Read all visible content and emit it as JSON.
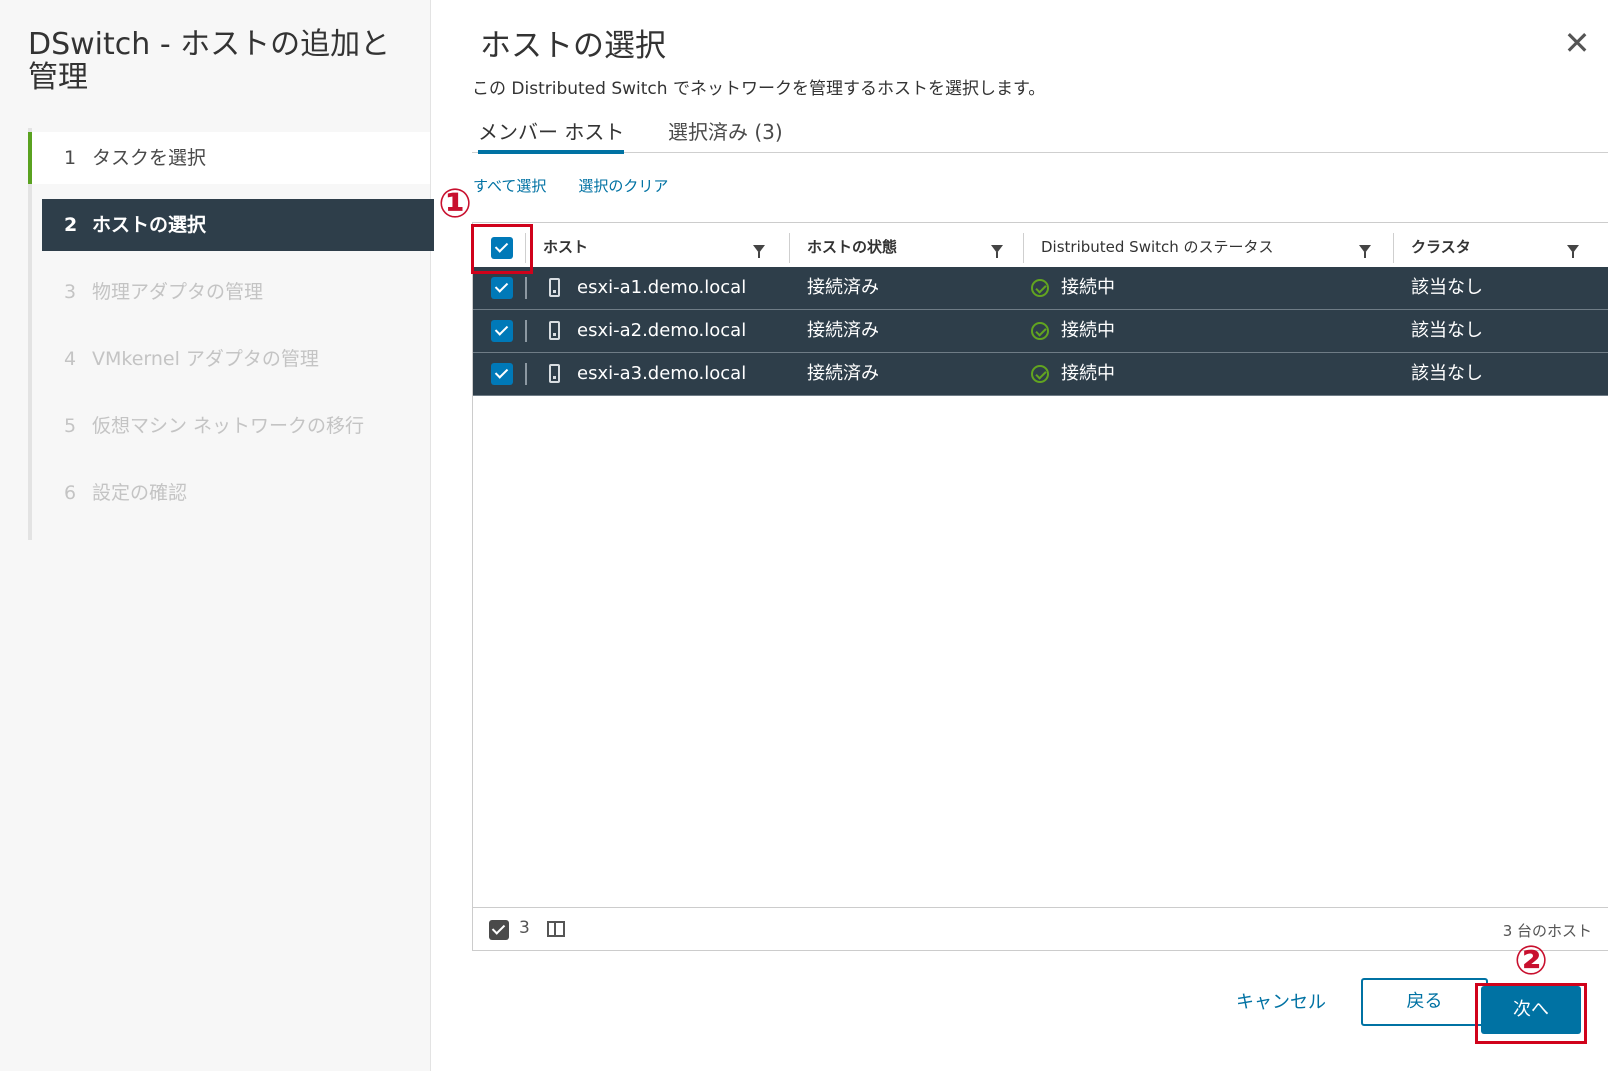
{
  "wizard": {
    "title": "DSwitch - ホストの追加と管理",
    "steps": [
      {
        "num": "1",
        "label": "タスクを選択"
      },
      {
        "num": "2",
        "label": "ホストの選択"
      },
      {
        "num": "3",
        "label": "物理アダプタの管理"
      },
      {
        "num": "4",
        "label": "VMkernel アダプタの管理"
      },
      {
        "num": "5",
        "label": "仮想マシン ネットワークの移行"
      },
      {
        "num": "6",
        "label": "設定の確認"
      }
    ]
  },
  "page": {
    "title": "ホストの選択",
    "subtitle": "この Distributed Switch でネットワークを管理するホストを選択します。",
    "close_icon": "close-icon"
  },
  "tabs": [
    {
      "label": "メンバー ホスト"
    },
    {
      "label": "選択済み (3)"
    }
  ],
  "links": {
    "select_all": "すべて選択",
    "clear_selection": "選択のクリア"
  },
  "grid": {
    "columns": [
      "ホスト",
      "ホストの状態",
      "Distributed Switch のステータス",
      "クラスタ"
    ],
    "rows": [
      {
        "host": "esxi-a1.demo.local",
        "state": "接続済み",
        "ds_status": "接続中",
        "cluster": "該当なし"
      },
      {
        "host": "esxi-a2.demo.local",
        "state": "接続済み",
        "ds_status": "接続中",
        "cluster": "該当なし"
      },
      {
        "host": "esxi-a3.demo.local",
        "state": "接続済み",
        "ds_status": "接続中",
        "cluster": "該当なし"
      }
    ],
    "footer": {
      "selected_count": "3",
      "total": "3 台のホスト"
    }
  },
  "annotations": {
    "mark1": "①",
    "mark2": "②"
  },
  "buttons": {
    "cancel": "キャンセル",
    "back": "戻る",
    "next": "次へ"
  },
  "colors": {
    "accent": "#0072a3",
    "selected_row": "#2e3e4a",
    "success": "#62a420",
    "annotation_red": "#d0021b"
  }
}
